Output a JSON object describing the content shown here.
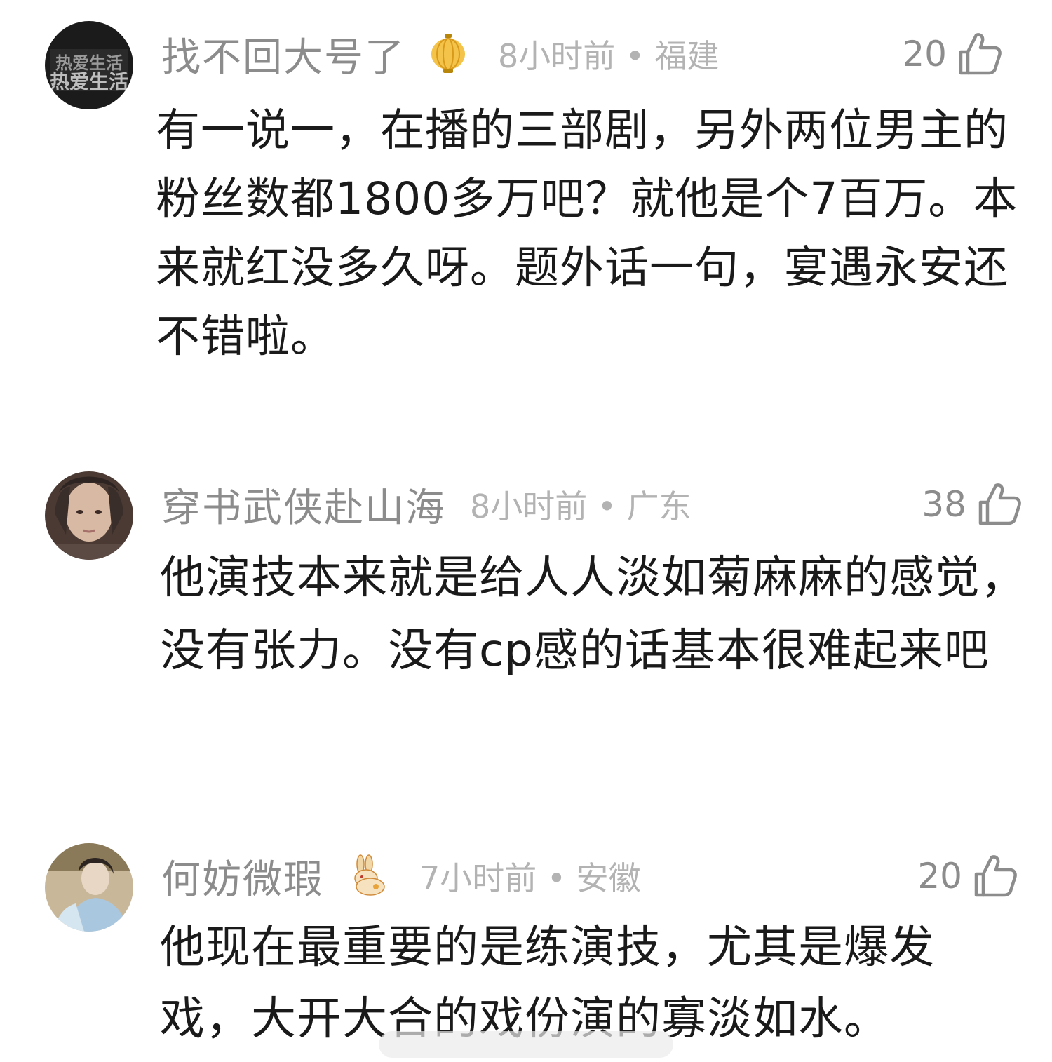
{
  "comments": [
    {
      "username": "找不回大号了",
      "time": "8小时前",
      "separator": "•",
      "location": "福建",
      "likes": "20",
      "avatar_text": "热爱生活",
      "content": "有一说一，在播的三部剧，另外两位男主的粉丝数都1800多万吧？就他是个7百万。本来就红没多久呀。题外话一句，宴遇永安还不错啦。"
    },
    {
      "username": "穿书武侠赴山海",
      "time": "8小时前",
      "separator": "•",
      "location": "广东",
      "likes": "38",
      "content": "他演技本来就是给人人淡如菊麻麻的感觉，没有张力。没有cp感的话基本很难起来吧"
    },
    {
      "username": "何妨微瑕",
      "time": "7小时前",
      "separator": "•",
      "location": "安徽",
      "likes": "20",
      "content": "他现在最重要的是练演技，尤其是爆发戏，大开大合的戏份演的寡淡如水。"
    }
  ],
  "colors": {
    "username": "#8c8c8c",
    "meta": "#b3b3b3",
    "text": "#1a1a1a",
    "background": "#ffffff"
  }
}
